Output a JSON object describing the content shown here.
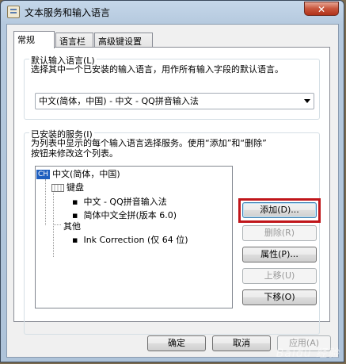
{
  "window": {
    "title": "文本服务和输入语言",
    "close_label": "✕"
  },
  "tabs": [
    {
      "label": "常规",
      "active": true
    },
    {
      "label": "语言栏",
      "active": false
    },
    {
      "label": "高级键设置",
      "active": false
    }
  ],
  "default_lang": {
    "title": "默认输入语言(L)",
    "description": "选择其中一个已安装的输入语言，用作所有输入字段的默认语言。",
    "selected": "中文(简体，中国) - 中文 - QQ拼音输入法"
  },
  "installed": {
    "title": "已安装的服务(I)",
    "description_line1": "为列表中显示的每个输入语言选择服务。使用“添加”和“删除”",
    "description_line2": "按钮来修改这个列表。",
    "tree": {
      "lang_badge": "CH",
      "lang_label": "中文(简体，中国)",
      "keyboard_label": "键盘",
      "kb_item1": "中文 - QQ拼音输入法",
      "kb_item2": "简体中文全拼(版本 6.0)",
      "other_label": "其他",
      "other_item1": "Ink Correction (仅 64 位)"
    },
    "buttons": {
      "add": "添加(D)...",
      "remove": "删除(R)",
      "properties": "属性(P)...",
      "move_up": "上移(U)",
      "move_down": "下移(O)"
    }
  },
  "footer": {
    "ok": "确定",
    "cancel": "取消",
    "apply": "应用(A)"
  },
  "watermark": "Baidu 经验"
}
